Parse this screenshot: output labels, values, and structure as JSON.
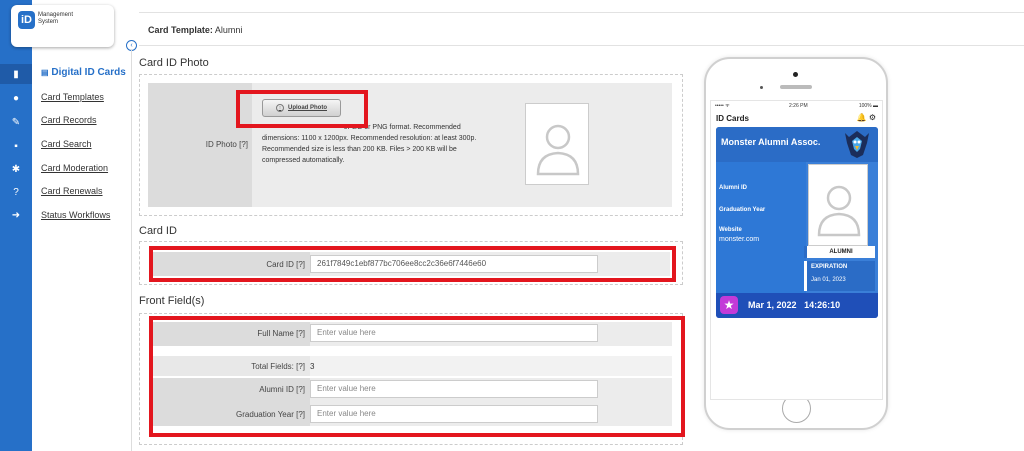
{
  "logo": {
    "mark": "iD",
    "line1": "Management",
    "line2": "System"
  },
  "rail_icons": [
    "id-card-icon",
    "chat-icon",
    "tools-icon",
    "document-icon",
    "gear-icon",
    "help-icon",
    "logout-icon"
  ],
  "nav": {
    "heading_icon": "▤",
    "heading": "Digital ID Cards",
    "items": [
      "Card Templates",
      "Card Records",
      "Card Search",
      "Card Moderation",
      "Card Renewals",
      "Status Workflows"
    ]
  },
  "header": {
    "label": "Card Template:",
    "value": "Alumni"
  },
  "photo_section": {
    "title": "Card ID Photo",
    "label": "ID Photo [?]",
    "upload_label": "Upload Photo",
    "help_line1": "JPEG or PNG format. Recommended",
    "help_line2": "dimensions: 1100 x 1200px. Recommended resolution: at least 300p.",
    "help_line3": "Recommended size is less than 200 KB. Files > 200 KB will be",
    "help_line4": "compressed automatically."
  },
  "cardid_section": {
    "title": "Card ID",
    "label": "Card ID [?]",
    "value": "261f7849c1ebf877bc706ee8cc2c36e6f7446e60"
  },
  "front_section": {
    "title": "Front Field(s)",
    "full_name_label": "Full Name [?]",
    "placeholder": "Enter value here",
    "total_label": "Total Fields: [?]",
    "total_value": "3",
    "alumni_id_label": "Alumni ID [?]",
    "grad_year_label": "Graduation Year [?]"
  },
  "phone": {
    "status_left": "••••• ᯤ",
    "status_time": "2:26 PM",
    "status_battery": "100% ▬",
    "app_title": "ID Cards",
    "icons": "🔔 ⚙",
    "card": {
      "org": "Monster Alumni Assoc.",
      "alumni_id_label": "Alumni ID",
      "grad_label": "Graduation Year",
      "website_label": "Website",
      "website_value": "monster.com",
      "badge": "ALUMNI",
      "exp_label": "EXPIRATION",
      "exp_value": "Jan 01, 2023",
      "date": "Mar 1, 2022",
      "time": "14:26:10",
      "star": "★"
    }
  },
  "colors": {
    "primary": "#2670c8",
    "highlight": "#e3161e",
    "card_blue": "#3a7fd8"
  }
}
